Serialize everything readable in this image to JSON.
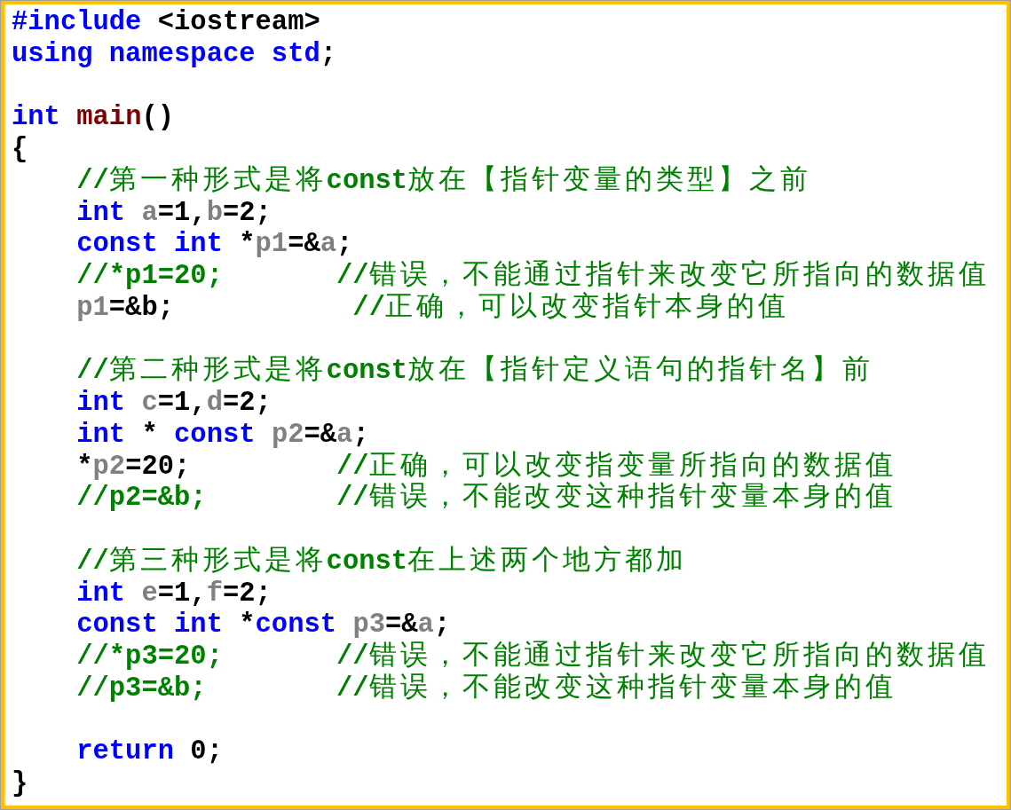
{
  "lines": [
    {
      "kind": "code",
      "indented": false,
      "tokens": [
        {
          "kind": "keyword",
          "text": "#include"
        },
        {
          "kind": "plain",
          "text": " <iostream>"
        }
      ]
    },
    {
      "kind": "code",
      "indented": false,
      "tokens": [
        {
          "kind": "keyword",
          "text": "using namespace std"
        },
        {
          "kind": "plain",
          "text": ";"
        }
      ]
    },
    {
      "kind": "blank"
    },
    {
      "kind": "code",
      "indented": false,
      "tokens": [
        {
          "kind": "keyword",
          "text": "int "
        },
        {
          "kind": "function",
          "text": "main"
        },
        {
          "kind": "plain",
          "text": "()"
        }
      ]
    },
    {
      "kind": "code",
      "indented": false,
      "tokens": [
        {
          "kind": "plain",
          "text": "{"
        }
      ]
    },
    {
      "kind": "code",
      "indented": true,
      "tokens": [
        {
          "kind": "comment",
          "text": "//第一种形式是将const放在【指针变量的类型】之前"
        }
      ]
    },
    {
      "kind": "code",
      "indented": true,
      "tokens": [
        {
          "kind": "keyword",
          "text": "int "
        },
        {
          "kind": "variable",
          "text": "a"
        },
        {
          "kind": "plain",
          "text": "=1,"
        },
        {
          "kind": "variable",
          "text": "b"
        },
        {
          "kind": "plain",
          "text": "=2;"
        }
      ]
    },
    {
      "kind": "code",
      "indented": true,
      "tokens": [
        {
          "kind": "keyword",
          "text": "const int"
        },
        {
          "kind": "plain",
          "text": " *"
        },
        {
          "kind": "variable",
          "text": "p1"
        },
        {
          "kind": "plain",
          "text": "=&"
        },
        {
          "kind": "variable",
          "text": "a"
        },
        {
          "kind": "plain",
          "text": ";"
        }
      ]
    },
    {
      "kind": "code",
      "indented": true,
      "tokens": [
        {
          "kind": "comment",
          "text": "//*p1=20;       //错误，不能通过指针来改变它所指向的数据值"
        }
      ]
    },
    {
      "kind": "code",
      "indented": true,
      "tokens": [
        {
          "kind": "variable",
          "text": "p1"
        },
        {
          "kind": "plain",
          "text": "=&b;"
        },
        {
          "kind": "comment",
          "text": "           //正确，可以改变指针本身的值"
        }
      ]
    },
    {
      "kind": "blank"
    },
    {
      "kind": "code",
      "indented": true,
      "tokens": [
        {
          "kind": "comment",
          "text": "//第二种形式是将const放在【指针定义语句的指针名】前"
        }
      ]
    },
    {
      "kind": "code",
      "indented": true,
      "tokens": [
        {
          "kind": "keyword",
          "text": "int "
        },
        {
          "kind": "variable",
          "text": "c"
        },
        {
          "kind": "plain",
          "text": "=1,"
        },
        {
          "kind": "variable",
          "text": "d"
        },
        {
          "kind": "plain",
          "text": "=2;"
        }
      ]
    },
    {
      "kind": "code",
      "indented": true,
      "tokens": [
        {
          "kind": "keyword",
          "text": "int"
        },
        {
          "kind": "plain",
          "text": " * "
        },
        {
          "kind": "keyword",
          "text": "const "
        },
        {
          "kind": "variable",
          "text": "p2"
        },
        {
          "kind": "plain",
          "text": "=&"
        },
        {
          "kind": "variable",
          "text": "a"
        },
        {
          "kind": "plain",
          "text": ";"
        }
      ]
    },
    {
      "kind": "code",
      "indented": true,
      "tokens": [
        {
          "kind": "plain",
          "text": "*"
        },
        {
          "kind": "variable",
          "text": "p2"
        },
        {
          "kind": "plain",
          "text": "=20;"
        },
        {
          "kind": "comment",
          "text": "         //正确，可以改变指变量所指向的数据值"
        }
      ]
    },
    {
      "kind": "code",
      "indented": true,
      "tokens": [
        {
          "kind": "comment",
          "text": "//p2=&b;        //错误，不能改变这种指针变量本身的值"
        }
      ]
    },
    {
      "kind": "blank"
    },
    {
      "kind": "code",
      "indented": true,
      "tokens": [
        {
          "kind": "comment",
          "text": "//第三种形式是将const在上述两个地方都加"
        }
      ]
    },
    {
      "kind": "code",
      "indented": true,
      "tokens": [
        {
          "kind": "keyword",
          "text": "int "
        },
        {
          "kind": "variable",
          "text": "e"
        },
        {
          "kind": "plain",
          "text": "=1,"
        },
        {
          "kind": "variable",
          "text": "f"
        },
        {
          "kind": "plain",
          "text": "=2;"
        }
      ]
    },
    {
      "kind": "code",
      "indented": true,
      "tokens": [
        {
          "kind": "keyword",
          "text": "const int"
        },
        {
          "kind": "plain",
          "text": " *"
        },
        {
          "kind": "keyword",
          "text": "const "
        },
        {
          "kind": "variable",
          "text": "p3"
        },
        {
          "kind": "plain",
          "text": "=&"
        },
        {
          "kind": "variable",
          "text": "a"
        },
        {
          "kind": "plain",
          "text": ";"
        }
      ]
    },
    {
      "kind": "code",
      "indented": true,
      "tokens": [
        {
          "kind": "comment",
          "text": "//*p3=20;       //错误，不能通过指针来改变它所指向的数据值"
        }
      ]
    },
    {
      "kind": "code",
      "indented": true,
      "tokens": [
        {
          "kind": "comment",
          "text": "//p3=&b;        //错误，不能改变这种指针变量本身的值"
        }
      ]
    },
    {
      "kind": "blank"
    },
    {
      "kind": "code",
      "indented": true,
      "tokens": [
        {
          "kind": "keyword",
          "text": "return"
        },
        {
          "kind": "plain",
          "text": " 0;"
        }
      ]
    },
    {
      "kind": "code",
      "indented": false,
      "tokens": [
        {
          "kind": "plain",
          "text": "}"
        }
      ]
    }
  ]
}
